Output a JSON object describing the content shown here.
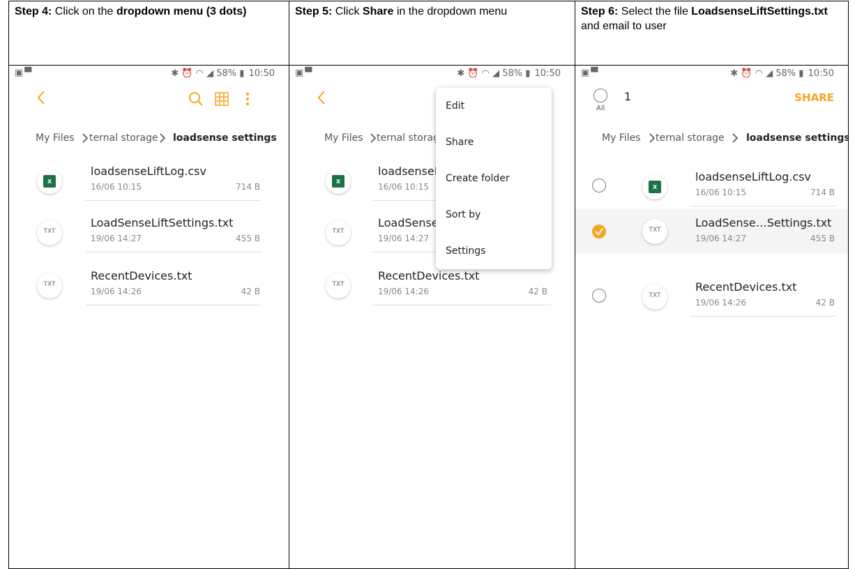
{
  "steps": [
    {
      "label": "Step 4:",
      "text_a": " Click on the ",
      "bold": "dropdown menu (3 dots)",
      "text_b": ""
    },
    {
      "label": "Step 5:",
      "text_a": " Click ",
      "bold": "Share",
      "text_b": " in the dropdown menu"
    },
    {
      "label": "Step 6:",
      "text_a": " Select the file ",
      "bold": "LoadsenseLiftSettings.txt",
      "text_b": " and email to user"
    }
  ],
  "status": {
    "battery": "58%",
    "time": "10:50"
  },
  "breadcrumb": {
    "root": "My Files",
    "middle": "ternal storage",
    "current": "loadsense settings",
    "middle_clipped": "ternal storage"
  },
  "files": [
    {
      "name": "loadsenseLiftLog.csv",
      "name_short": "loadsenseL",
      "date": "16/06 10:15",
      "size": "714 B",
      "type": "xls"
    },
    {
      "name": "LoadSenseLiftSettings.txt",
      "name_short": "LoadSense",
      "name_trunc": "LoadSense…Settings.txt",
      "date": "19/06 14:27",
      "size": "455 B",
      "type": "TXT"
    },
    {
      "name": "RecentDevices.txt",
      "date": "19/06 14:26",
      "size": "42 B",
      "type": "TXT"
    }
  ],
  "menu": [
    "Edit",
    "Share",
    "Create folder",
    "Sort by",
    "Settings"
  ],
  "selection": {
    "count": "1",
    "all_label": "All",
    "share": "SHARE"
  },
  "colors": {
    "accent": "#f5a623",
    "excel": "#1e7145"
  }
}
